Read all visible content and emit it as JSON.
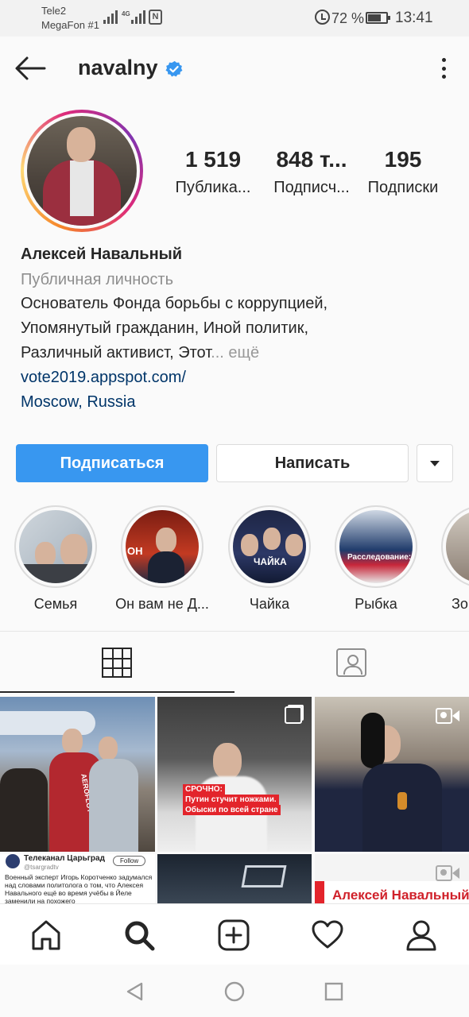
{
  "status_bar": {
    "carrier1": "Tele2",
    "carrier2": "MegaFon #1",
    "network_type": "4G",
    "nfc": "N",
    "battery_percent": "72 %",
    "battery_level": 0.72,
    "time": "13:41"
  },
  "header": {
    "username": "navalny",
    "verified": true,
    "icons": {
      "back": "arrow-left-icon",
      "verified": "verified-badge-icon",
      "more": "more-vertical-icon"
    }
  },
  "stats": {
    "posts_count": "1 519",
    "posts_label": "Публика...",
    "followers_count": "848 т...",
    "followers_label": "Подписч...",
    "following_count": "195",
    "following_label": "Подписки"
  },
  "bio": {
    "full_name": "Алексей Навальный",
    "category": "Публичная личность",
    "line1": "Основатель Фонда борьбы с коррупцией,",
    "line2": "Упомянутый гражданин, Иной политик,",
    "line3": "Различный активист, Этот",
    "more_ellipsis": "... ещё",
    "website": "vote2019.appspot.com/",
    "location": "Moscow, Russia"
  },
  "actions": {
    "follow_label": "Подписаться",
    "message_label": "Написать",
    "dropdown_icon": "chevron-down-icon"
  },
  "highlights": [
    {
      "label": "Семья"
    },
    {
      "label": "Он вам не Д..."
    },
    {
      "label": "Чайка"
    },
    {
      "label": "Рыбка"
    },
    {
      "label": "Зо"
    }
  ],
  "highlight_texts": {
    "hl2_tag": "ОН",
    "hl3_title": "ЧАЙКА",
    "hl4_banner": "Расследование:"
  },
  "tabs": {
    "grid_icon": "grid-icon",
    "tagged_icon": "tagged-photos-icon",
    "active": "grid"
  },
  "posts": {
    "p1_jacket_text": "AEROFLOT",
    "p2_headline1": "СРОЧНО:",
    "p2_headline2": "Путин стучит ножками.",
    "p2_headline3": "Обыски по всей стране",
    "p4_channel": "Телеканал Царьград",
    "p4_handle": "@tsargradtv",
    "p4_follow": "Follow",
    "p4_text": "Военный эксперт Игорь Коротченко задумался над словами политолога о том, что Алексея Навального ещё во время учёбы в Йеле заменили на похожего",
    "p6_banner": "Алексей Навальный"
  },
  "bottom_nav": {
    "icons": [
      "home-icon",
      "search-icon",
      "add-post-icon",
      "activity-heart-icon",
      "profile-icon"
    ]
  },
  "colors": {
    "accent_blue": "#3897f0",
    "link_blue": "#003569",
    "verified_blue": "#3897f0",
    "red_banner": "#e3242b"
  }
}
